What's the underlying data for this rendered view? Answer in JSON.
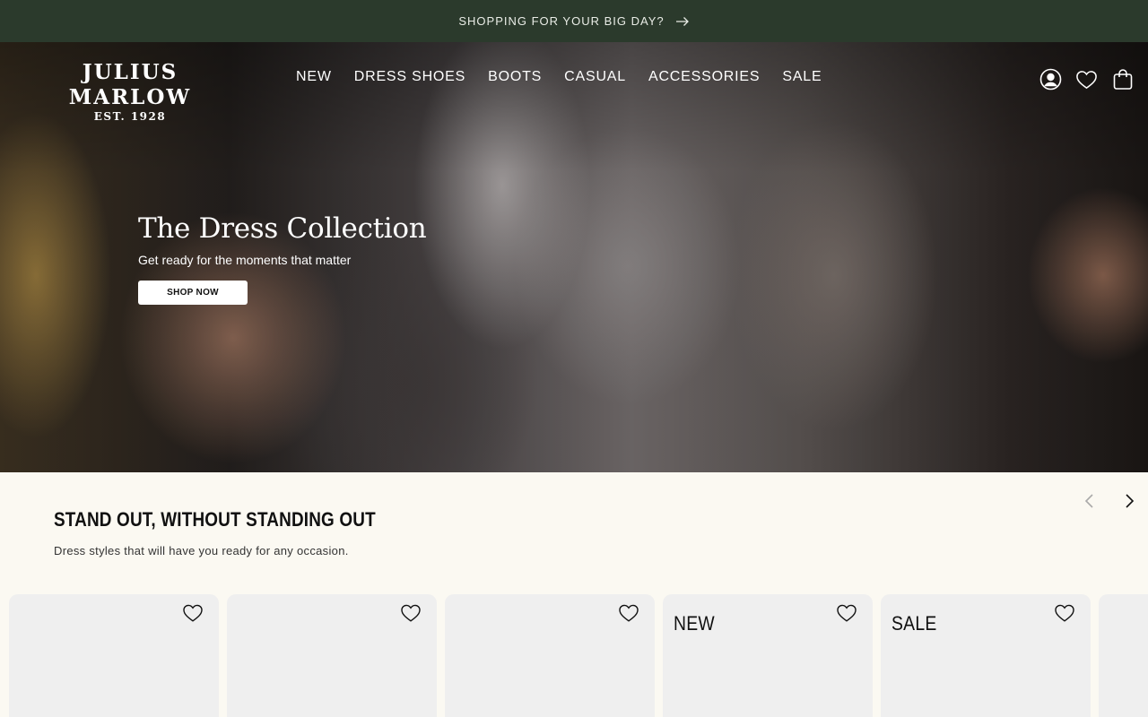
{
  "announcement": {
    "text": "SHOPPING FOR YOUR BIG DAY?",
    "icon": "arrow-right-icon"
  },
  "brand": {
    "name": "JULIUS MARLOW",
    "established": "EST. 1928"
  },
  "nav": {
    "items": [
      {
        "label": "NEW"
      },
      {
        "label": "DRESS SHOES"
      },
      {
        "label": "BOOTS"
      },
      {
        "label": "CASUAL"
      },
      {
        "label": "ACCESSORIES"
      },
      {
        "label": "SALE"
      }
    ]
  },
  "header_icons": [
    "account-icon",
    "wishlist-heart-icon",
    "cart-bag-icon"
  ],
  "hero": {
    "title": "The Dress Collection",
    "subtitle": "Get ready for the moments that matter",
    "cta": "SHOP NOW"
  },
  "section": {
    "title": "STAND OUT, WITHOUT STANDING OUT",
    "subtitle": "Dress styles that will have you ready for any occasion.",
    "prev_icon": "chevron-left-icon",
    "next_icon": "chevron-right-icon"
  },
  "products": [
    {
      "badge": ""
    },
    {
      "badge": ""
    },
    {
      "badge": ""
    },
    {
      "badge": "NEW"
    },
    {
      "badge": "SALE"
    },
    {
      "badge": ""
    }
  ],
  "colors": {
    "announcement_bg": "#2b3a2c",
    "page_bg": "#fbf9f2",
    "card_bg": "#efefef"
  }
}
